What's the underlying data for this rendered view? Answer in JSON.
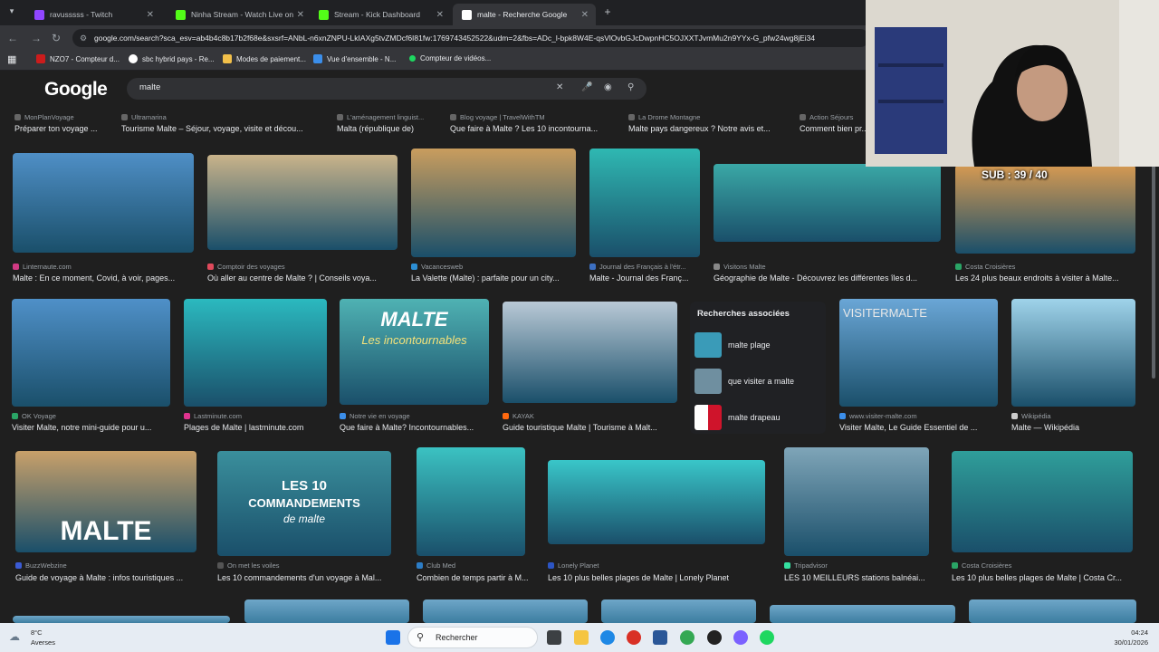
{
  "browser": {
    "tabs": [
      {
        "title": "ravusssss - Twitch",
        "color": "#9146ff"
      },
      {
        "title": "Ninha Stream - Watch Live on Kick",
        "color": "#53fc18"
      },
      {
        "title": "Stream - Kick Dashboard",
        "color": "#53fc18"
      },
      {
        "title": "malte - Recherche Google",
        "color": "#ffffff"
      }
    ],
    "new_tab_label": "+",
    "url": "google.com/search?sca_esv=ab4b4c8b17b2f68e&sxsrf=ANbL-n6xnZNPU-LkIAXg5tvZMDcf6I81fw:1769743452522&udm=2&fbs=ADc_l-bpk8W4E-qsVlOvbGJcDwpnHC5OJXXTJvmMu2n9YYx-G_pfw24wg8jEi34",
    "bookmarks": [
      {
        "label": "NZO7 - Compteur d...",
        "color": "#cc1c1c"
      },
      {
        "label": "sbc hybrid pays - Re...",
        "color": "#ffffff"
      },
      {
        "label": "Modes de paiement...",
        "color": "#f2c04a"
      },
      {
        "label": "Vue d'ensemble - N...",
        "color": "#3b8eea"
      },
      {
        "label": "Compteur de vidéos...",
        "color": "#1ed760"
      }
    ]
  },
  "google": {
    "logo": "Google",
    "query": "malte",
    "top_row": [
      {
        "source": "MonPlanVoyage",
        "caption": "Préparer ton voyage ..."
      },
      {
        "source": "Ultramarina",
        "caption": "Tourisme Malte – Séjour, voyage, visite et décou..."
      },
      {
        "source": "L'aménagement linguist...",
        "caption": "Malta (république de)"
      },
      {
        "source": "Blog voyage | TravelWithTM",
        "caption": "Que faire à Malte ? Les 10 incontourna..."
      },
      {
        "source": "La Drome Montagne",
        "caption": "Malte pays dangereux ? Notre avis et..."
      },
      {
        "source": "Action Séjours",
        "caption": "Comment bien pr..."
      }
    ],
    "row1": [
      {
        "source": "Linternaute.com",
        "caption": "Malte : En ce moment, Covid, à voir, pages...",
        "color": "#d13a83",
        "bg": "#4f8fc6"
      },
      {
        "source": "Comptoir des voyages",
        "caption": "Où aller au centre de Malte ? | Conseils voya...",
        "color": "#e04a5c",
        "bg": "#c9b38a"
      },
      {
        "source": "Vacancesweb",
        "caption": "La Valette (Malte) : parfaite pour un city...",
        "color": "#2c8fd4",
        "bg": "#c99d5e"
      },
      {
        "source": "Journal des Français à l'étr...",
        "caption": "Malte - Journal des Franç...",
        "color": "#3c6fc1",
        "bg": "#2fb8b2"
      },
      {
        "source": "Visitons Malte",
        "caption": "Géographie de Malte - Découvrez les différentes îles d...",
        "color": "#888888",
        "bg": "#3aa8a6"
      },
      {
        "source": "Costa Croisières",
        "caption": "Les 24 plus beaux endroits à visiter à Malte...",
        "color": "#2aa566",
        "bg": "#d69a52"
      }
    ],
    "row2": [
      {
        "source": "OK Voyage",
        "caption": "Visiter Malte, notre mini-guide pour u...",
        "color": "#2aa566",
        "bg": "#4f90c8"
      },
      {
        "source": "Lastminute.com",
        "caption": "Plages de Malte | lastminute.com",
        "color": "#e0338f",
        "bg": "#2bb9bf"
      },
      {
        "source": "Notre vie en voyage",
        "caption": "Que faire à Malte? Incontournables...",
        "color": "#3b8eea",
        "bg": "#4fb2b3"
      },
      {
        "source": "KAYAK",
        "caption": "Guide touristique Malte | Tourisme à Malt...",
        "color": "#ff690f",
        "bg": "#b9c9d6"
      },
      {
        "source": "www.visiter-malte.com",
        "caption": "Visiter Malte, Le Guide Essentiel de ...",
        "color": "#3b8eea",
        "bg": "#6aa6d6"
      },
      {
        "source": "Wikipédia",
        "caption": "Malte — Wikipédia",
        "color": "#cccccc",
        "bg": "#9fd3ea"
      }
    ],
    "row3": [
      {
        "source": "BuzzWebzine",
        "caption": "Guide de voyage à Malte : infos touristiques ...",
        "color": "#3b5bd4",
        "bg": "#c8a06a"
      },
      {
        "source": "On met les voiles",
        "caption": "Les 10 commandements d'un voyage à Mal...",
        "color": "#555555",
        "bg": "#3a8f9c"
      },
      {
        "source": "Club Med",
        "caption": "Combien de temps partir à M...",
        "color": "#2c7dc7",
        "bg": "#3bc2c2"
      },
      {
        "source": "Lonely Planet",
        "caption": "Les 10 plus belles plages de Malte | Lonely Planet",
        "color": "#2c55c4",
        "bg": "#39c6c9"
      },
      {
        "source": "Tripadvisor",
        "caption": "LES 10 MEILLEURS stations balnéai...",
        "color": "#34e0a1",
        "bg": "#7fa5b8"
      },
      {
        "source": "Costa Croisières",
        "caption": "Les 10 plus belles plages de Malte | Costa Cr...",
        "color": "#2aa566",
        "bg": "#2f9e9a"
      }
    ],
    "overlay_texts": {
      "malte": "MALTE",
      "incontournables": "Les incontournables",
      "visiter": "VISITERMALTE",
      "malte_big": "MALTE",
      "les10": "LES 10",
      "commandements": "COMMANDEMENTS",
      "de_malte": "de malte"
    },
    "related": {
      "title": "Recherches associées",
      "items": [
        {
          "label": "malte plage",
          "color": "#3a9bb8"
        },
        {
          "label": "que visiter a malte",
          "color": "#6f8fa0"
        },
        {
          "label": "malte drapeau",
          "color": "#cf142b"
        }
      ]
    }
  },
  "stream": {
    "sub_counter": "SUB : 39 / 40"
  },
  "taskbar": {
    "weather_temp": "8°C",
    "weather_desc": "Averses",
    "search_placeholder": "Rechercher",
    "time": "04:24",
    "date": "30/01/2026"
  }
}
